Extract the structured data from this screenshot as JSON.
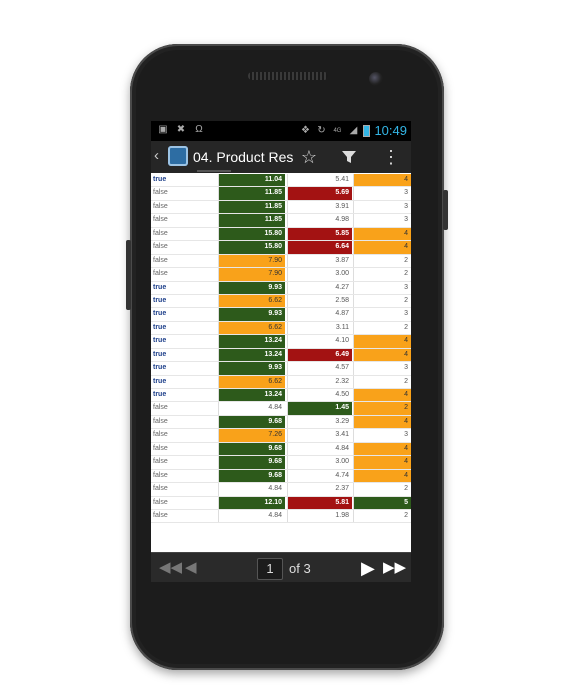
{
  "status": {
    "time": "10:49",
    "net": "4G"
  },
  "actionbar": {
    "title": "04. Product Resu"
  },
  "icons": {
    "back": "back-chevron-icon",
    "app": "app-logo-icon",
    "favorite": "star-outline-icon",
    "filter": "filter-icon",
    "overflow": "overflow-menu-icon"
  },
  "colors": {
    "green": "#2d5a1b",
    "red": "#a31212",
    "orange": "#f9a21a",
    "accent": "#33b5e5"
  },
  "rows": [
    {
      "flag": "true",
      "v1": "11.04",
      "c1": "green",
      "v2": "5.41",
      "c2": "plain",
      "v3": "4",
      "c3": "orange"
    },
    {
      "flag": "false",
      "v1": "11.85",
      "c1": "green",
      "v2": "5.69",
      "c2": "red",
      "v3": "3",
      "c3": "plain"
    },
    {
      "flag": "false",
      "v1": "11.85",
      "c1": "green",
      "v2": "3.91",
      "c2": "plain",
      "v3": "3",
      "c3": "plain"
    },
    {
      "flag": "false",
      "v1": "11.85",
      "c1": "green",
      "v2": "4.98",
      "c2": "plain",
      "v3": "3",
      "c3": "plain"
    },
    {
      "flag": "false",
      "v1": "15.80",
      "c1": "green",
      "v2": "5.85",
      "c2": "red",
      "v3": "4",
      "c3": "orange"
    },
    {
      "flag": "false",
      "v1": "15.80",
      "c1": "green",
      "v2": "6.64",
      "c2": "red",
      "v3": "4",
      "c3": "orange"
    },
    {
      "flag": "false",
      "v1": "7.90",
      "c1": "orange",
      "v2": "3.87",
      "c2": "plain",
      "v3": "2",
      "c3": "plain"
    },
    {
      "flag": "false",
      "v1": "7.90",
      "c1": "orange",
      "v2": "3.00",
      "c2": "plain",
      "v3": "2",
      "c3": "plain"
    },
    {
      "flag": "true",
      "v1": "9.93",
      "c1": "green",
      "v2": "4.27",
      "c2": "plain",
      "v3": "3",
      "c3": "plain"
    },
    {
      "flag": "true",
      "v1": "6.62",
      "c1": "orange",
      "v2": "2.58",
      "c2": "plain",
      "v3": "2",
      "c3": "plain"
    },
    {
      "flag": "true",
      "v1": "9.93",
      "c1": "green",
      "v2": "4.87",
      "c2": "plain",
      "v3": "3",
      "c3": "plain"
    },
    {
      "flag": "true",
      "v1": "6.62",
      "c1": "orange",
      "v2": "3.11",
      "c2": "plain",
      "v3": "2",
      "c3": "plain"
    },
    {
      "flag": "true",
      "v1": "13.24",
      "c1": "green",
      "v2": "4.10",
      "c2": "plain",
      "v3": "4",
      "c3": "orange"
    },
    {
      "flag": "true",
      "v1": "13.24",
      "c1": "green",
      "v2": "6.49",
      "c2": "red",
      "v3": "4",
      "c3": "orange"
    },
    {
      "flag": "true",
      "v1": "9.93",
      "c1": "green",
      "v2": "4.57",
      "c2": "plain",
      "v3": "3",
      "c3": "plain"
    },
    {
      "flag": "true",
      "v1": "6.62",
      "c1": "orange",
      "v2": "2.32",
      "c2": "plain",
      "v3": "2",
      "c3": "plain"
    },
    {
      "flag": "true",
      "v1": "13.24",
      "c1": "green",
      "v2": "4.50",
      "c2": "plain",
      "v3": "4",
      "c3": "orange"
    },
    {
      "flag": "false",
      "v1": "4.84",
      "c1": "plain",
      "v2": "1.45",
      "c2": "green",
      "v3": "2",
      "c3": "orange"
    },
    {
      "flag": "false",
      "v1": "9.68",
      "c1": "green",
      "v2": "3.29",
      "c2": "plain",
      "v3": "4",
      "c3": "orange"
    },
    {
      "flag": "false",
      "v1": "7.26",
      "c1": "orange",
      "v2": "3.41",
      "c2": "plain",
      "v3": "3",
      "c3": "plain"
    },
    {
      "flag": "false",
      "v1": "9.68",
      "c1": "green",
      "v2": "4.84",
      "c2": "plain",
      "v3": "4",
      "c3": "orange"
    },
    {
      "flag": "false",
      "v1": "9.68",
      "c1": "green",
      "v2": "3.00",
      "c2": "plain",
      "v3": "4",
      "c3": "orange"
    },
    {
      "flag": "false",
      "v1": "9.68",
      "c1": "green",
      "v2": "4.74",
      "c2": "plain",
      "v3": "4",
      "c3": "orange"
    },
    {
      "flag": "false",
      "v1": "4.84",
      "c1": "plain",
      "v2": "2.37",
      "c2": "plain",
      "v3": "2",
      "c3": "plain"
    },
    {
      "flag": "false",
      "v1": "12.10",
      "c1": "green",
      "v2": "5.81",
      "c2": "red",
      "v3": "5",
      "c3": "green"
    },
    {
      "flag": "false",
      "v1": "4.84",
      "c1": "plain",
      "v2": "1.98",
      "c2": "plain",
      "v3": "2",
      "c3": "plain"
    }
  ],
  "pager": {
    "page": "1",
    "of_label": "of 3"
  }
}
